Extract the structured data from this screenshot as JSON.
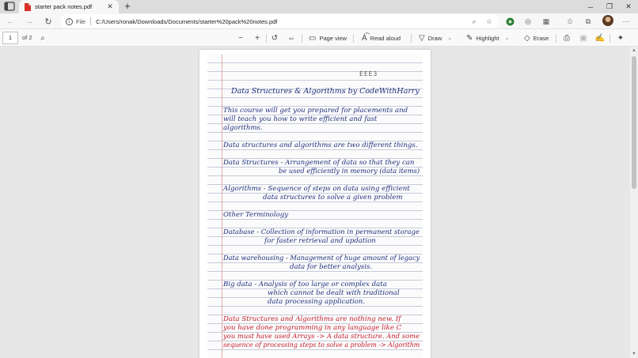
{
  "browser": {
    "tab": {
      "title": "starter pack notes.pdf",
      "icon": "pdf-file-icon"
    },
    "window_controls": [
      "minimize-icon",
      "maximize-icon",
      "close-icon"
    ],
    "address": {
      "file_label": "File",
      "url": "C:/Users/ronak/Downloads/Documents/starter%20pack%20notes.pdf"
    }
  },
  "pdf_toolbar": {
    "page_current": "1",
    "page_total": "of 2",
    "page_view_label": "Page view",
    "read_aloud_label": "Read aloud",
    "draw_label": "Draw",
    "highlight_label": "Highlight",
    "erase_label": "Erase"
  },
  "document": {
    "title": "Data Structures & Algorithms by CodeWithHarry",
    "lines": [
      "This course will get you prepared for placements and",
      "will teach you how to write efficient and fast",
      "algorithms.",
      "Data structures and algorithms are two different things.",
      "Data Structures - Arrangement of data so that they can",
      "be used efficiently in memory (data items)",
      "Algorithms - Sequence of steps on data using efficient",
      "data structures to solve a given problem",
      "Other Terminology",
      "Database - Collection of information in permanent storage",
      "for faster retrieval and updation",
      "Data warehousing - Management of huge amount of legacy",
      "data for better analysis.",
      "Big data - Analysis of too large or complex data",
      "which cannot be dealt with traditional",
      "data processing application."
    ],
    "red_lines": [
      "Data Structures and Algorithms are nothing new. If",
      "you have done programming in any language like C",
      "you must have used Arrays -> A data structure. And some",
      "sequence of processing steps to solve a problem -> Algorithm"
    ]
  },
  "colors": {
    "ink_blue": "#1f2f7a",
    "ink_red": "#c21d2a",
    "viewer_bg": "#e7e7e7"
  }
}
